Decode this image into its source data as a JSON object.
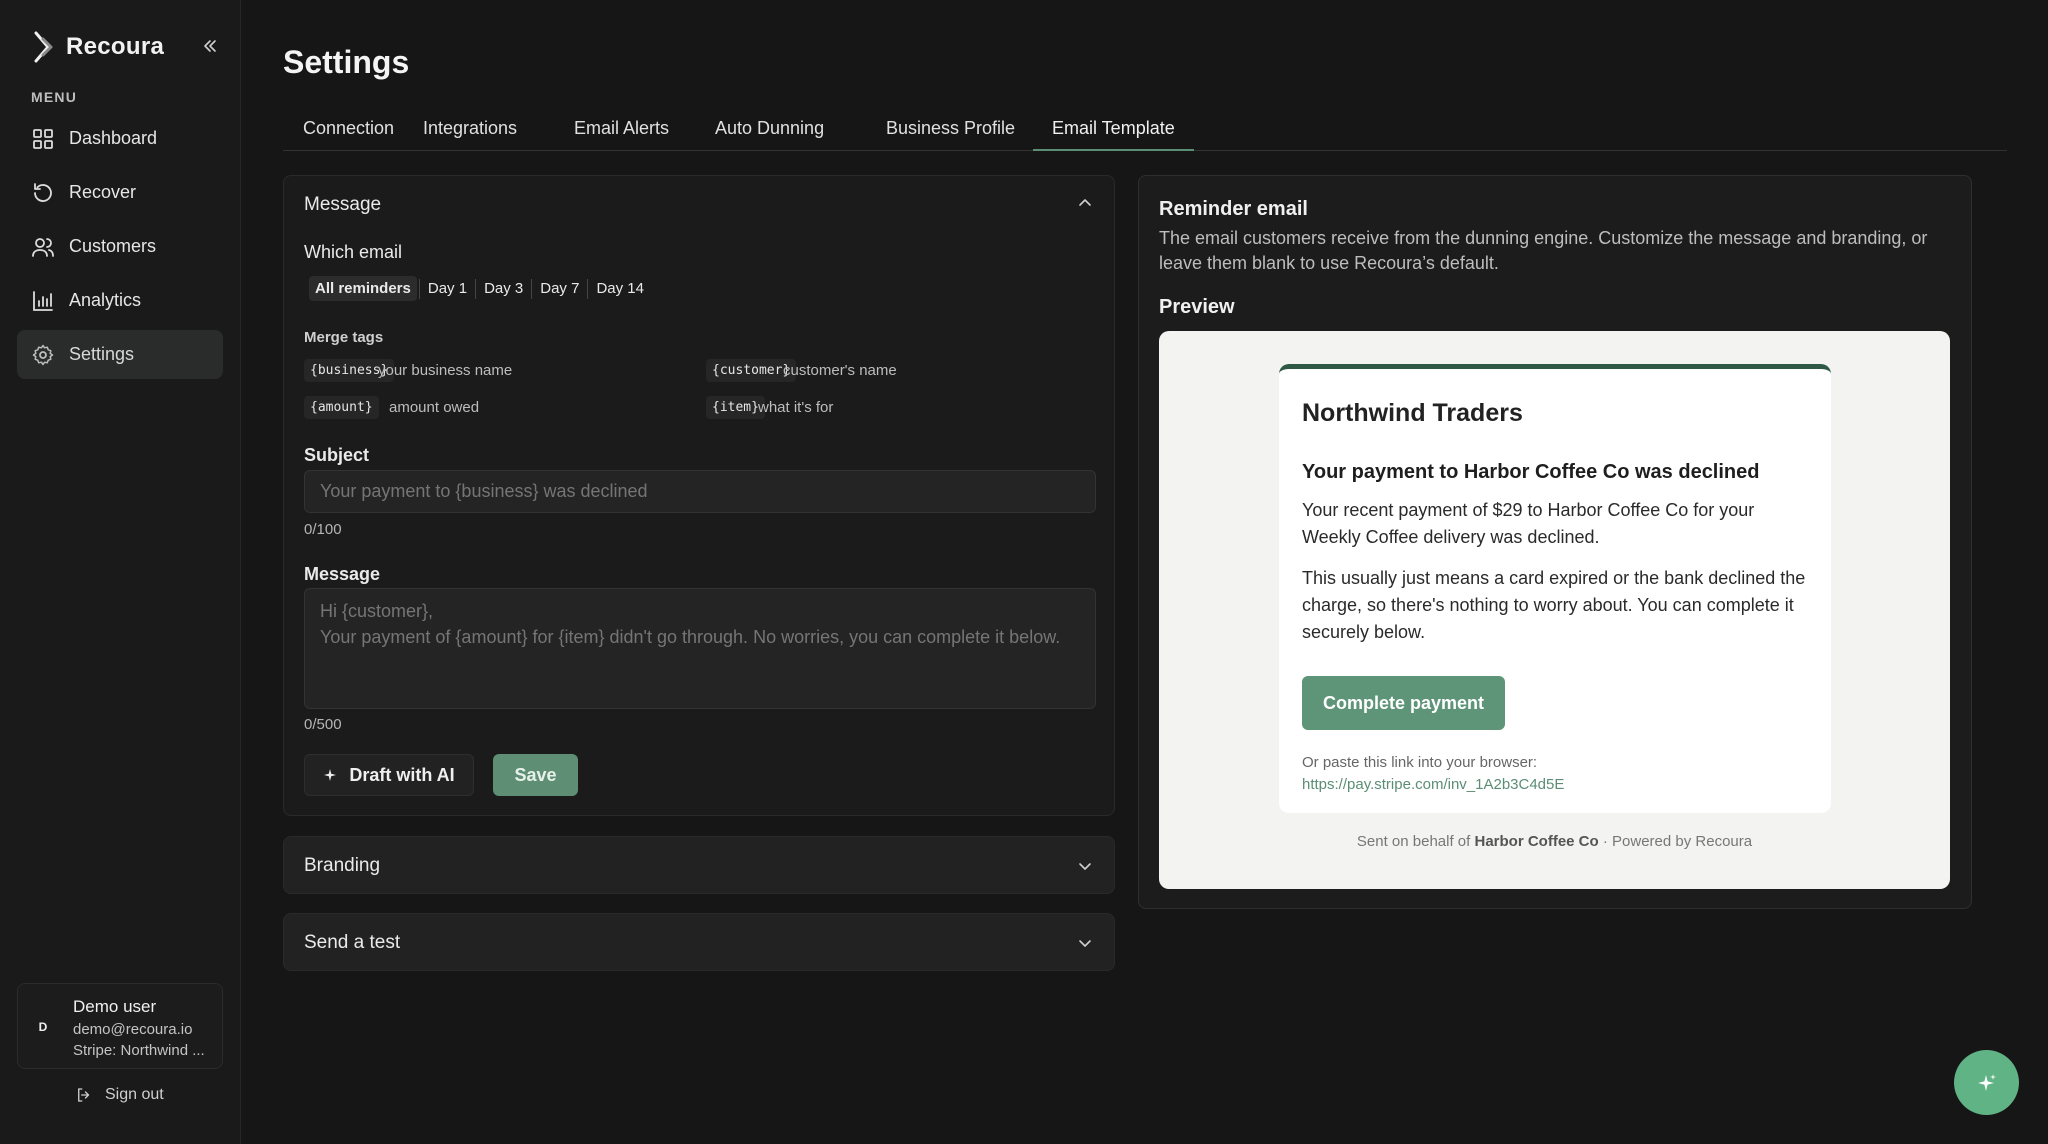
{
  "app": {
    "name": "Recoura"
  },
  "sidebar": {
    "menu_label": "MENU",
    "items": [
      {
        "label": "Dashboard",
        "icon": "dashboard-icon"
      },
      {
        "label": "Recover",
        "icon": "rotate-icon"
      },
      {
        "label": "Customers",
        "icon": "users-icon"
      },
      {
        "label": "Analytics",
        "icon": "bar-chart-icon"
      },
      {
        "label": "Settings",
        "icon": "gear-icon",
        "active": true
      }
    ],
    "user": {
      "initial": "D",
      "name": "Demo user",
      "email": "demo@recoura.io",
      "stripe": "Stripe: Northwind ..."
    },
    "sign_out": "Sign out"
  },
  "page": {
    "title": "Settings"
  },
  "tabs": [
    {
      "label": "Connection"
    },
    {
      "label": "Integrations"
    },
    {
      "label": "Email Alerts"
    },
    {
      "label": "Auto Dunning"
    },
    {
      "label": "Business Profile"
    },
    {
      "label": "Email Template",
      "active": true
    }
  ],
  "message_panel": {
    "title": "Message",
    "which_email_label": "Which email",
    "which_email_options": [
      "All reminders",
      "Day 1",
      "Day 3",
      "Day 7",
      "Day 14"
    ],
    "selected_option": "All reminders",
    "merge_tags_label": "Merge tags",
    "merge_tags": [
      {
        "tag": "{business}",
        "desc": "your business name"
      },
      {
        "tag": "{customer}",
        "desc": "customer's name"
      },
      {
        "tag": "{amount}",
        "desc": "amount owed"
      },
      {
        "tag": "{item}",
        "desc": "what it's for"
      }
    ],
    "subject_label": "Subject",
    "subject_value": "",
    "subject_placeholder": "Your payment to {business} was declined",
    "subject_counter": "0/100",
    "message_label": "Message",
    "message_value": "",
    "message_placeholder": "Hi {customer},\nYour payment of {amount} for {item} didn't go through. No worries, you can complete it below.",
    "message_counter": "0/500",
    "draft_ai_label": "Draft with AI",
    "save_label": "Save"
  },
  "branding_panel": {
    "title": "Branding"
  },
  "send_test_panel": {
    "title": "Send a test"
  },
  "preview_panel": {
    "title": "Reminder email",
    "description": "The email customers receive from the dunning engine. Customize the message and branding, or leave them blank to use Recoura’s default.",
    "preview_label": "Preview",
    "email": {
      "business_name": "Northwind Traders",
      "heading": "Your payment to Harbor Coffee Co was declined",
      "paragraph1": "Your recent payment of $29 to Harbor Coffee Co for your Weekly Coffee delivery was declined.",
      "paragraph2": "This usually just means a card expired or the bank declined the charge, so there's nothing to worry about. You can complete it securely below.",
      "button_label": "Complete payment",
      "or_paste": "Or paste this link into your browser:",
      "link": "https://pay.stripe.com/inv_1A2b3C4d5E",
      "footer_prefix": "Sent on behalf of",
      "footer_business": "Harbor Coffee Co",
      "footer_suffix": "· Powered by Recoura"
    }
  },
  "colors": {
    "accent": "#5e8f74",
    "email_top_bar": "#2e5a45",
    "fab": "#5fb385",
    "background": "#161616"
  }
}
